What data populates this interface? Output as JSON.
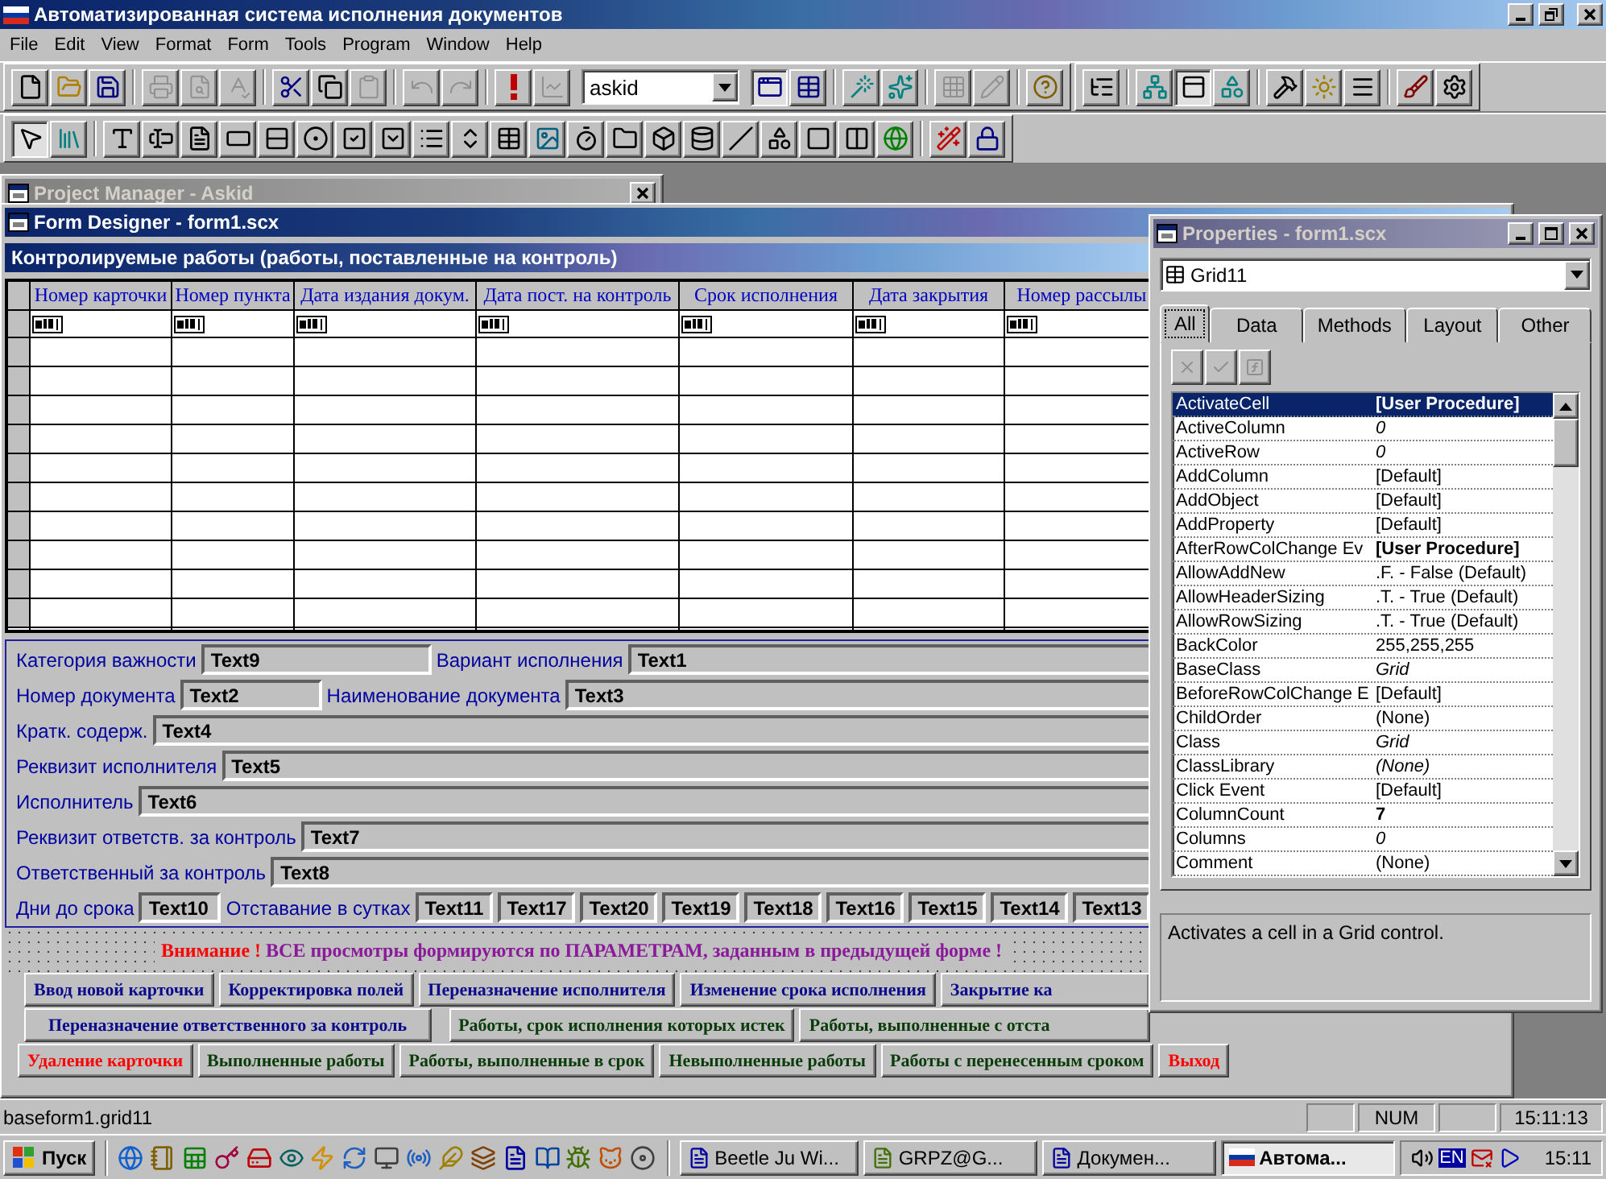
{
  "window": {
    "title": "Автоматизированная система исполнения документов"
  },
  "menu": [
    "File",
    "Edit",
    "View",
    "Format",
    "Form",
    "Tools",
    "Program",
    "Window",
    "Help"
  ],
  "standard_toolbar": {
    "combo_value": "askid",
    "buttons": [
      {
        "pressed": false,
        "disabled": false
      },
      {
        "pressed": false,
        "disabled": false
      },
      {
        "pressed": false,
        "disabled": false
      },
      {
        "pressed": false,
        "disabled": true
      },
      {
        "pressed": false,
        "disabled": true
      },
      {
        "pressed": false,
        "disabled": true
      },
      {
        "pressed": false,
        "disabled": false
      },
      {
        "pressed": false,
        "disabled": false
      },
      {
        "pressed": false,
        "disabled": true
      },
      {
        "pressed": false,
        "disabled": true
      },
      {
        "pressed": false,
        "disabled": true
      },
      {
        "pressed": false,
        "disabled": false
      },
      {
        "pressed": false,
        "disabled": true
      },
      {
        "pressed": true,
        "disabled": false
      },
      {
        "pressed": false,
        "disabled": false
      },
      {
        "pressed": false,
        "disabled": false
      },
      {
        "pressed": false,
        "disabled": false
      },
      {
        "pressed": false,
        "disabled": true
      },
      {
        "pressed": false,
        "disabled": true
      },
      {
        "pressed": false,
        "disabled": false
      },
      {
        "pressed": false,
        "disabled": false
      },
      {
        "pressed": false,
        "disabled": false
      },
      {
        "pressed": true,
        "disabled": false
      },
      {
        "pressed": false,
        "disabled": false
      },
      {
        "pressed": false,
        "disabled": false
      },
      {
        "pressed": false,
        "disabled": false
      },
      {
        "pressed": false,
        "disabled": false
      },
      {
        "pressed": false,
        "disabled": false
      },
      {
        "pressed": false,
        "disabled": false
      }
    ]
  },
  "controls_toolbar": {
    "buttons": [
      {
        "pressed": true
      },
      {
        "pressed": false
      },
      {
        "pressed": false
      },
      {
        "pressed": false
      },
      {
        "pressed": false
      },
      {
        "pressed": false
      },
      {
        "pressed": false
      },
      {
        "pressed": false
      },
      {
        "pressed": false
      },
      {
        "pressed": false
      },
      {
        "pressed": false
      },
      {
        "pressed": false
      },
      {
        "pressed": false
      },
      {
        "pressed": false
      },
      {
        "pressed": false
      },
      {
        "pressed": false
      },
      {
        "pressed": false
      },
      {
        "pressed": false
      },
      {
        "pressed": false
      },
      {
        "pressed": false
      },
      {
        "pressed": false
      },
      {
        "pressed": false
      },
      {
        "pressed": false
      },
      {
        "pressed": false
      },
      {
        "pressed": false
      }
    ]
  },
  "project_manager": {
    "title": "Project Manager - Askid"
  },
  "form_designer": {
    "title": "Form Designer - form1.scx",
    "form_caption": "Контролируемые работы  (работы, поставленные на контроль)",
    "grid": {
      "columns": [
        "Номер карточки",
        "Номер пункта",
        "Дата  издания докум.",
        "Дата пост. на контроль",
        "Срок исполнения",
        "Дата закрытия",
        "Номер рассылы"
      ]
    },
    "field_rows": [
      [
        {
          "kind": "label",
          "text": "Категория важности"
        },
        {
          "kind": "field",
          "text": "Text9"
        },
        {
          "kind": "label",
          "text": "Вариант исполнения"
        },
        {
          "kind": "stretch",
          "text": "Text1"
        }
      ],
      [
        {
          "kind": "label",
          "text": "Номер документа"
        },
        {
          "kind": "field",
          "text": "Text2"
        },
        {
          "kind": "label",
          "text": "Наименование документа"
        },
        {
          "kind": "stretch",
          "text": "Text3"
        }
      ],
      [
        {
          "kind": "label",
          "text": "Кратк. содерж."
        },
        {
          "kind": "stretch",
          "text": "Text4"
        }
      ],
      [
        {
          "kind": "label",
          "text": "Реквизит исполнителя"
        },
        {
          "kind": "stretch",
          "text": "Text5"
        }
      ],
      [
        {
          "kind": "label",
          "text": "Исполнитель"
        },
        {
          "kind": "stretch",
          "text": "Text6"
        }
      ],
      [
        {
          "kind": "label",
          "text": "Реквизит ответств. за контроль"
        },
        {
          "kind": "stretch",
          "text": "Text7"
        }
      ],
      [
        {
          "kind": "label",
          "text": "Ответственный за контроль"
        },
        {
          "kind": "stretch",
          "text": "Text8"
        }
      ],
      [
        {
          "kind": "label",
          "text": "Дни до срока"
        },
        {
          "kind": "field",
          "text": "Text10"
        },
        {
          "kind": "label",
          "text": "Отставание в сутках"
        },
        {
          "kind": "small",
          "text": "Text11"
        },
        {
          "kind": "small",
          "text": "Text17"
        },
        {
          "kind": "small",
          "text": "Text20"
        },
        {
          "kind": "small",
          "text": "Text19"
        },
        {
          "kind": "small",
          "text": "Text18"
        },
        {
          "kind": "small",
          "text": "Text16"
        },
        {
          "kind": "small",
          "text": "Text15"
        },
        {
          "kind": "small",
          "text": "Text14"
        },
        {
          "kind": "small",
          "text": "Text13"
        }
      ]
    ],
    "warning": {
      "lead": "Внимание !",
      "text": "ВСЕ просмотры  формируются по ПАРАМЕТРАМ, заданным в предыдущей форме !"
    },
    "button_rows": [
      [
        {
          "label": "Ввод новой карточки",
          "color": "#0a0a8c"
        },
        {
          "label": "Корректировка полей",
          "color": "#0a0a8c"
        },
        {
          "label": "Переназначение исполнителя",
          "color": "#0a0a8c"
        },
        {
          "label": "Изменение срока исполнения",
          "color": "#0a0a8c"
        },
        {
          "label": "Закрытие ка",
          "color": "#0a0a8c"
        }
      ],
      [
        {
          "label": "Переназначение ответственного за контроль",
          "color": "#0a0a8c"
        },
        {
          "label": "Работы, срок исполнения которых истек",
          "color": "#0a3c0a"
        },
        {
          "label": "Работы, выполненные с отста",
          "color": "#0a3c0a"
        }
      ],
      [
        {
          "label": "Удаление карточки",
          "color": "#ff0000"
        },
        {
          "label": "Выполненные работы",
          "color": "#0a3c0a"
        },
        {
          "label": "Работы, выполненные в срок",
          "color": "#0a3c0a"
        },
        {
          "label": "Невыполненные работы",
          "color": "#0a3c0a"
        },
        {
          "label": "Работы с перенесенным сроком",
          "color": "#0a3c0a"
        },
        {
          "label": "Выход",
          "color": "#ff0000"
        }
      ]
    ]
  },
  "properties": {
    "title": "Properties - form1.scx",
    "object": "Grid11",
    "tabs": [
      {
        "label": "All",
        "selected": true
      },
      {
        "label": "Data",
        "selected": false
      },
      {
        "label": "Methods",
        "selected": false
      },
      {
        "label": "Layout",
        "selected": false
      },
      {
        "label": "Other",
        "selected": false
      }
    ],
    "rows": [
      {
        "name": "ActivateCell",
        "value": "[User Procedure]",
        "kind": "bold",
        "selected": true
      },
      {
        "name": "ActiveColumn",
        "value": "0",
        "kind": "italic",
        "selected": false
      },
      {
        "name": "ActiveRow",
        "value": "0",
        "kind": "italic",
        "selected": false
      },
      {
        "name": "AddColumn",
        "value": "[Default]",
        "kind": "plain",
        "selected": false
      },
      {
        "name": "AddObject",
        "value": "[Default]",
        "kind": "plain",
        "selected": false
      },
      {
        "name": "AddProperty",
        "value": "[Default]",
        "kind": "plain",
        "selected": false
      },
      {
        "name": "AfterRowColChange Ev",
        "value": "[User Procedure]",
        "kind": "bold",
        "selected": false
      },
      {
        "name": "AllowAddNew",
        "value": ".F. - False (Default)",
        "kind": "plain",
        "selected": false
      },
      {
        "name": "AllowHeaderSizing",
        "value": ".T. - True (Default)",
        "kind": "plain",
        "selected": false
      },
      {
        "name": "AllowRowSizing",
        "value": ".T. - True (Default)",
        "kind": "plain",
        "selected": false
      },
      {
        "name": "BackColor",
        "value": "255,255,255",
        "kind": "plain",
        "selected": false
      },
      {
        "name": "BaseClass",
        "value": "Grid",
        "kind": "italic",
        "selected": false
      },
      {
        "name": "BeforeRowColChange E",
        "value": "[Default]",
        "kind": "plain",
        "selected": false
      },
      {
        "name": "ChildOrder",
        "value": "(None)",
        "kind": "plain",
        "selected": false
      },
      {
        "name": "Class",
        "value": "Grid",
        "kind": "italic",
        "selected": false
      },
      {
        "name": "ClassLibrary",
        "value": "(None)",
        "kind": "italic",
        "selected": false
      },
      {
        "name": "Click Event",
        "value": "[Default]",
        "kind": "plain",
        "selected": false
      },
      {
        "name": "ColumnCount",
        "value": "7",
        "kind": "bold",
        "selected": false
      },
      {
        "name": "Columns",
        "value": "0",
        "kind": "italic",
        "selected": false
      },
      {
        "name": "Comment",
        "value": "(None)",
        "kind": "plain",
        "selected": false
      }
    ],
    "description": "Activates a cell in a Grid control."
  },
  "status_bar": {
    "text": "baseform1.grid11",
    "indicator": "NUM",
    "time": "15:11:13"
  },
  "taskbar": {
    "start": "Пуск",
    "tasks": [
      {
        "label": "Beetle Ju Wi...",
        "selected": false
      },
      {
        "label": "GRPZ@G...",
        "selected": false
      },
      {
        "label": "Докумен...",
        "selected": false
      },
      {
        "label": "Автома...",
        "selected": true
      }
    ],
    "language": "EN",
    "clock": "15:11"
  }
}
